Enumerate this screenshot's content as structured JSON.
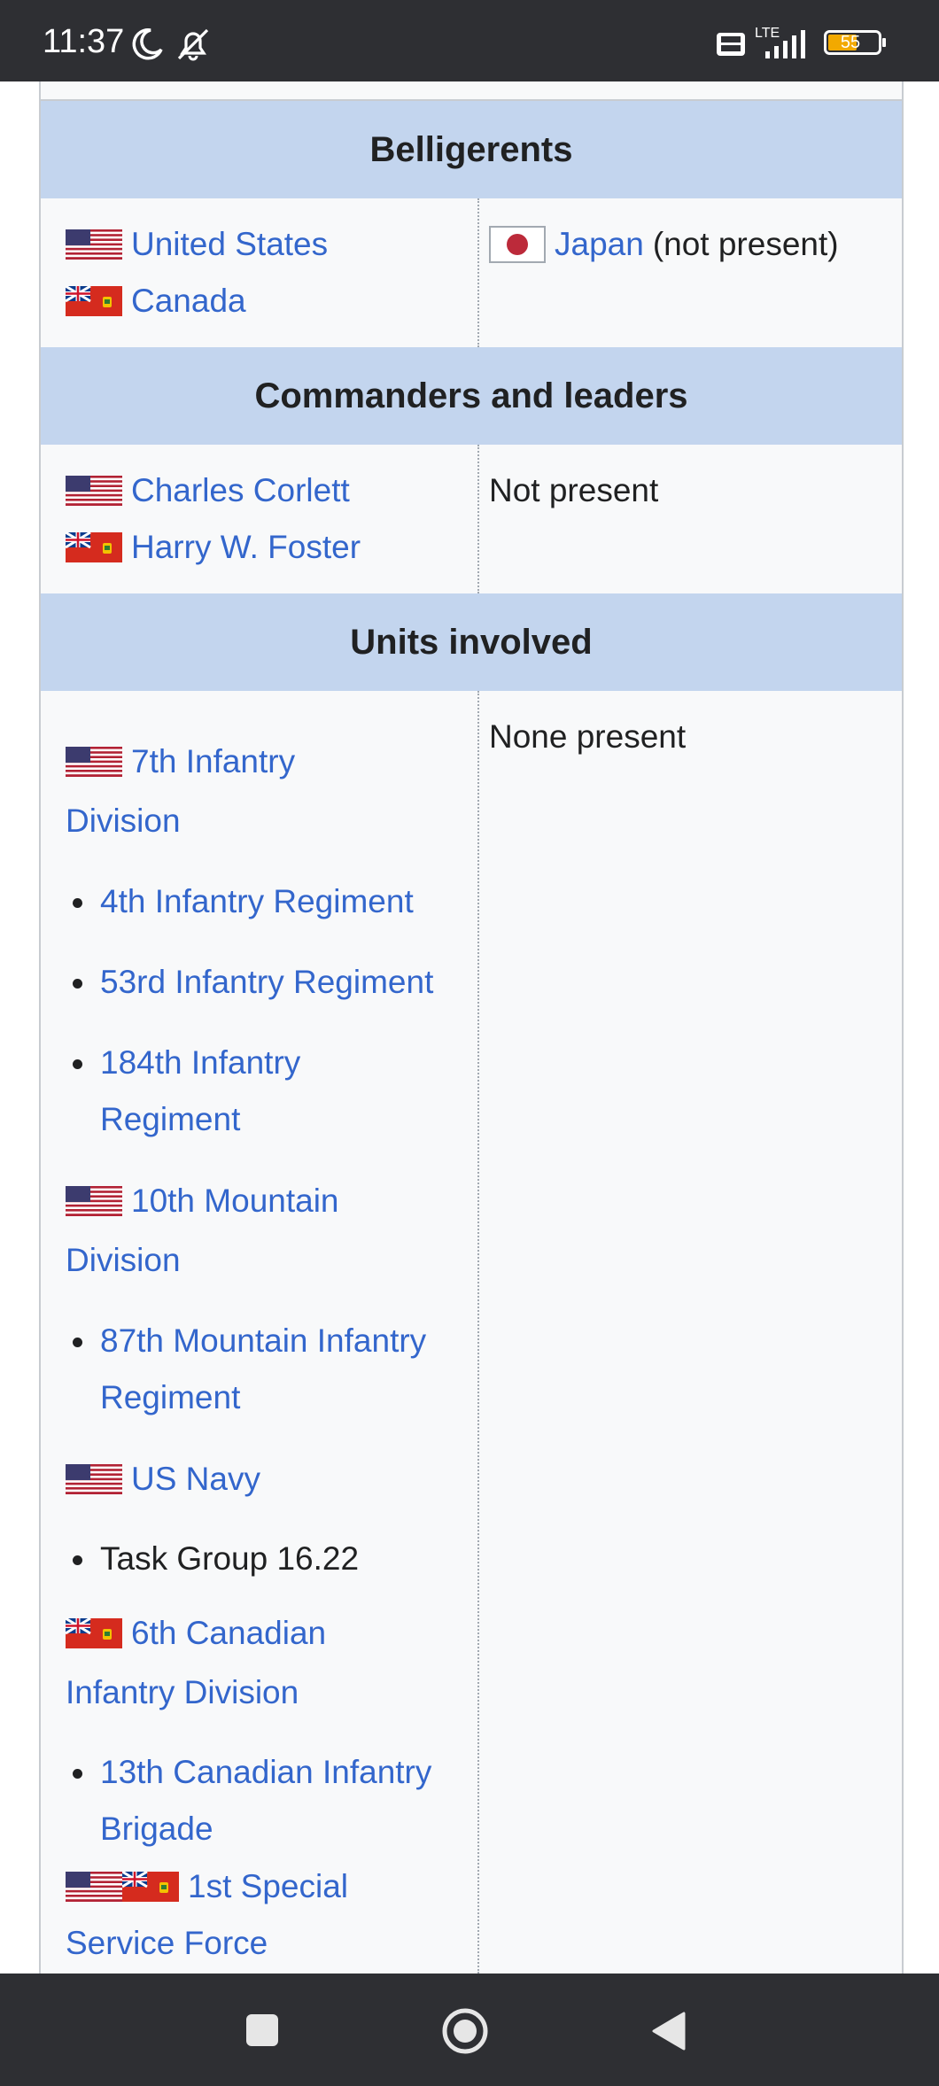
{
  "status_bar": {
    "time": "11:37",
    "battery": "55",
    "network": "LTE"
  },
  "infobox": {
    "belligerents_header": "Belligerents",
    "allies": [
      "United States",
      "Canada"
    ],
    "enemy_link": "Japan",
    "enemy_note": "(not present)",
    "commanders_header": "Commanders and leaders",
    "commanders": [
      "Charles Corlett",
      "Harry W. Foster"
    ],
    "enemy_commanders": "Not present",
    "units_header": "Units involved",
    "enemy_units": "None present",
    "units": {
      "div7": "7th Infantry",
      "div7b": "Division",
      "reg4": "4th Infantry Regiment",
      "reg53": "53rd Infantry Regiment",
      "reg184a": "184th Infantry",
      "reg184b": "Regiment",
      "div10a": "10th Mountain",
      "div10b": "Division",
      "reg87a": "87th Mountain Infantry",
      "reg87b": "Regiment",
      "navy": "US Navy",
      "tg": "Task Group 16.22",
      "can6a": "6th Canadian",
      "can6b": "Infantry Division",
      "brig13a": "13th Canadian Infantry",
      "brig13b": "Brigade",
      "ssf_a": "1st Special",
      "ssf_b": "Service Force"
    }
  },
  "icons": [
    "us-flag-icon",
    "canada-red-ensign-icon",
    "japan-flag-icon",
    "moon-icon",
    "bell-off-icon",
    "signal-icon",
    "battery-icon",
    "square-icon",
    "home-circle-icon",
    "back-triangle-icon"
  ]
}
